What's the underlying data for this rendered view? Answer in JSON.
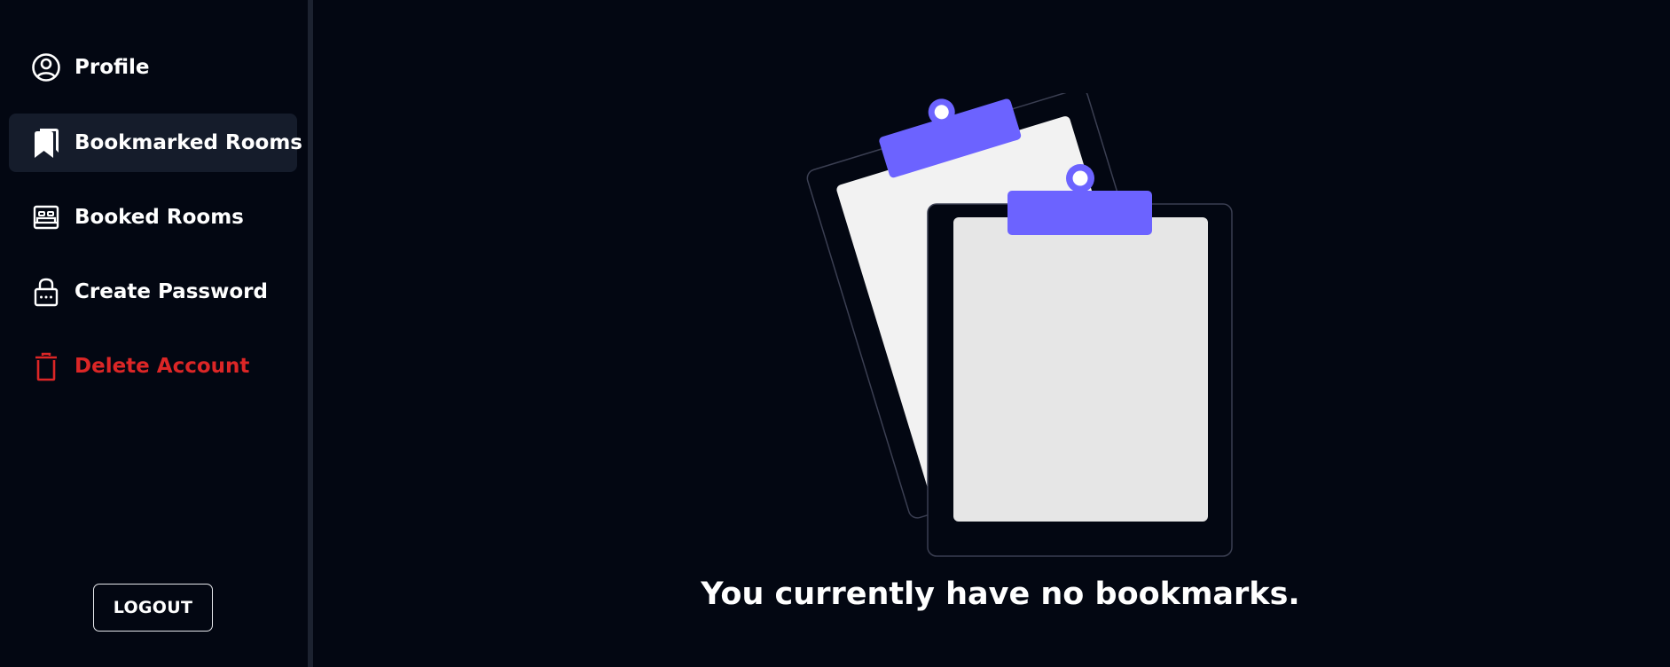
{
  "sidebar": {
    "items": [
      {
        "label": "Profile",
        "icon": "user-circle-icon"
      },
      {
        "label": "Bookmarked Rooms",
        "icon": "bookmark-icon",
        "active": true
      },
      {
        "label": "Booked Rooms",
        "icon": "bed-icon"
      },
      {
        "label": "Create Password",
        "icon": "lock-icon"
      },
      {
        "label": "Delete Account",
        "icon": "trash-icon",
        "danger": true
      }
    ],
    "logout_label": "LOGOUT"
  },
  "main": {
    "empty_message": "You currently have no bookmarks.",
    "illustration": "empty-clipboards-illustration"
  },
  "colors": {
    "background": "#030712",
    "active_item": "#151c2b",
    "danger": "#dc2626",
    "accent": "#6c63ff"
  }
}
